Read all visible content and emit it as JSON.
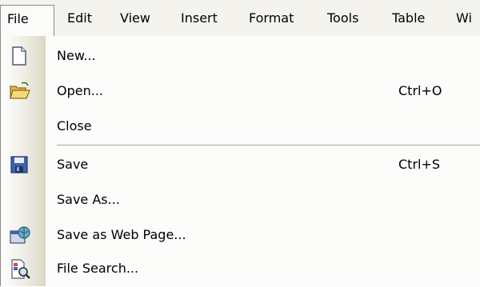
{
  "menubar": {
    "items": [
      {
        "label": "File"
      },
      {
        "label": "Edit"
      },
      {
        "label": "View"
      },
      {
        "label": "Insert"
      },
      {
        "label": "Format"
      },
      {
        "label": "Tools"
      },
      {
        "label": "Table"
      },
      {
        "label": "Wi"
      }
    ]
  },
  "menu": {
    "items": [
      {
        "label": "New...",
        "icon": "new-document-icon"
      },
      {
        "label": "Open...",
        "shortcut": "Ctrl+O",
        "icon": "open-folder-icon"
      },
      {
        "label": "Close"
      },
      {
        "label": "Save",
        "shortcut": "Ctrl+S",
        "icon": "save-icon"
      },
      {
        "label": "Save As..."
      },
      {
        "label": "Save as Web Page...",
        "icon": "web-page-icon"
      },
      {
        "label": "File Search...",
        "icon": "file-search-icon"
      }
    ]
  }
}
